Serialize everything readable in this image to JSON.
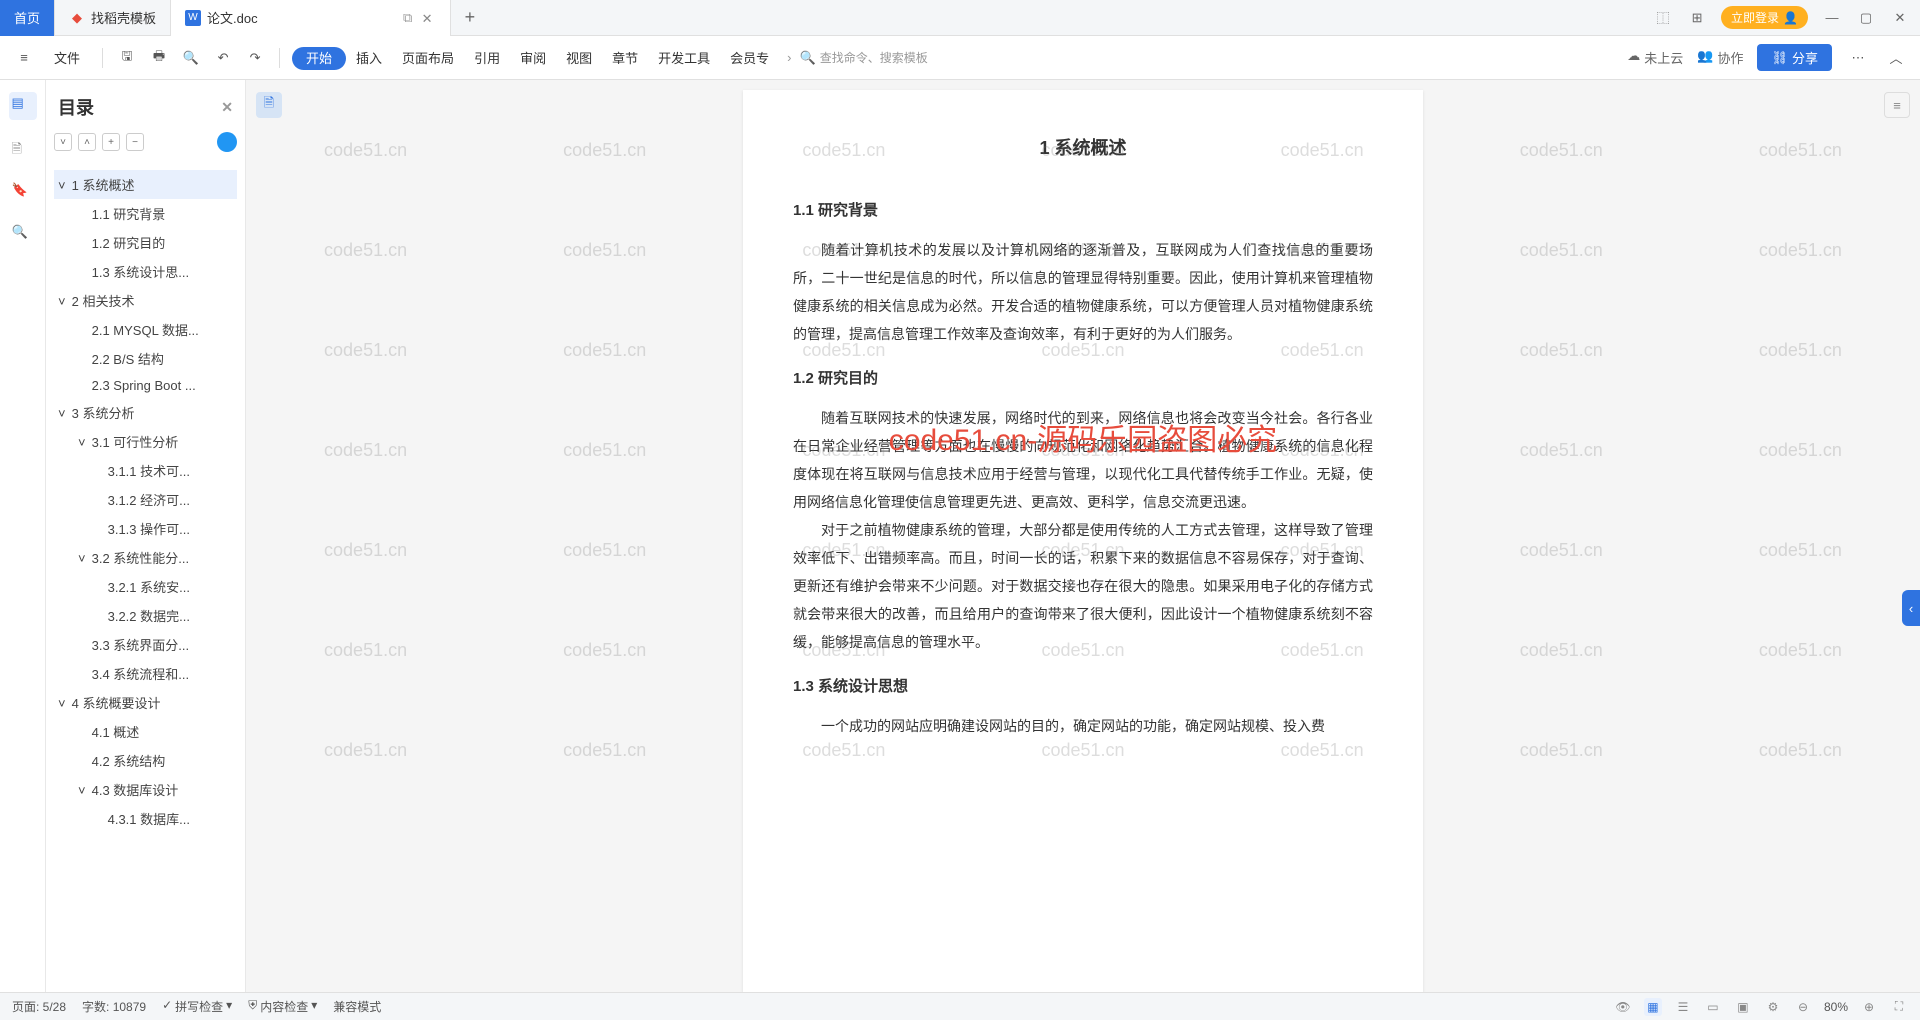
{
  "tabs": {
    "home": "首页",
    "t1": "找稻壳模板",
    "t2": "论文.doc"
  },
  "titlebar": {
    "login": "立即登录"
  },
  "toolbar": {
    "file": "文件",
    "menus": [
      "开始",
      "插入",
      "页面布局",
      "引用",
      "审阅",
      "视图",
      "章节",
      "开发工具",
      "会员专"
    ],
    "search_placeholder": "查找命令、搜索模板",
    "cloud": "未上云",
    "collab": "协作",
    "share": "分享"
  },
  "sidebar": {
    "title": "目录",
    "items": [
      {
        "lvl": 1,
        "chev": "˅",
        "text": "1 系统概述",
        "sel": true
      },
      {
        "lvl": 2,
        "text": "1.1 研究背景"
      },
      {
        "lvl": 2,
        "text": "1.2 研究目的"
      },
      {
        "lvl": 2,
        "text": "1.3 系统设计思..."
      },
      {
        "lvl": 1,
        "chev": "˅",
        "text": "2 相关技术"
      },
      {
        "lvl": 2,
        "text": "2.1 MYSQL 数据..."
      },
      {
        "lvl": 2,
        "text": "2.2 B/S 结构"
      },
      {
        "lvl": 2,
        "text": "2.3 Spring Boot ..."
      },
      {
        "lvl": 1,
        "chev": "˅",
        "text": "3 系统分析"
      },
      {
        "lvl": 2,
        "chev": "˅",
        "text": "3.1 可行性分析"
      },
      {
        "lvl": 3,
        "text": "3.1.1 技术可..."
      },
      {
        "lvl": 3,
        "text": "3.1.2 经济可..."
      },
      {
        "lvl": 3,
        "text": "3.1.3 操作可..."
      },
      {
        "lvl": 2,
        "chev": "˅",
        "text": "3.2 系统性能分..."
      },
      {
        "lvl": 3,
        "text": "3.2.1 系统安..."
      },
      {
        "lvl": 3,
        "text": "3.2.2 数据完..."
      },
      {
        "lvl": 2,
        "text": "3.3 系统界面分..."
      },
      {
        "lvl": 2,
        "text": "3.4 系统流程和..."
      },
      {
        "lvl": 1,
        "chev": "˅",
        "text": "4 系统概要设计"
      },
      {
        "lvl": 2,
        "text": "4.1 概述"
      },
      {
        "lvl": 2,
        "text": "4.2 系统结构"
      },
      {
        "lvl": 2,
        "chev": "˅",
        "text": "4.3 数据库设计"
      },
      {
        "lvl": 3,
        "text": "4.3.1 数据库..."
      }
    ]
  },
  "doc": {
    "h1": "1 系统概述",
    "s1": "1.1 研究背景",
    "p1": "随着计算机技术的发展以及计算机网络的逐渐普及，互联网成为人们查找信息的重要场所，二十一世纪是信息的时代，所以信息的管理显得特别重要。因此，使用计算机来管理植物健康系统的相关信息成为必然。开发合适的植物健康系统，可以方便管理人员对植物健康系统的管理，提高信息管理工作效率及查询效率，有利于更好的为人们服务。",
    "s2": "1.2 研究目的",
    "p2": "随着互联网技术的快速发展，网络时代的到来，网络信息也将会改变当今社会。各行各业在日常企业经营管理等方面也在慢慢的向规范化和网络化趋势汇合。植物健康系统的信息化程度体现在将互联网与信息技术应用于经营与管理，以现代化工具代替传统手工作业。无疑，使用网络信息化管理使信息管理更先进、更高效、更科学，信息交流更迅速。",
    "p3": "对于之前植物健康系统的管理，大部分都是使用传统的人工方式去管理，这样导致了管理效率低下、出错频率高。而且，时间一长的话，积累下来的数据信息不容易保存，对于查询、更新还有维护会带来不少问题。对于数据交接也存在很大的隐患。如果采用电子化的存储方式就会带来很大的改善，而且给用户的查询带来了很大便利，因此设计一个植物健康系统刻不容缓，能够提高信息的管理水平。",
    "s3": "1.3 系统设计思想",
    "p4": "一个成功的网站应明确建设网站的目的，确定网站的功能，确定网站规模、投入费"
  },
  "watermark": {
    "text": "code51.cn",
    "red": "code51.cn-源码乐园盗图必究"
  },
  "status": {
    "page": "页面: 5/28",
    "words": "字数: 10879",
    "spell": "拼写检查",
    "content": "内容检查",
    "compat": "兼容模式",
    "zoom": "80%"
  }
}
